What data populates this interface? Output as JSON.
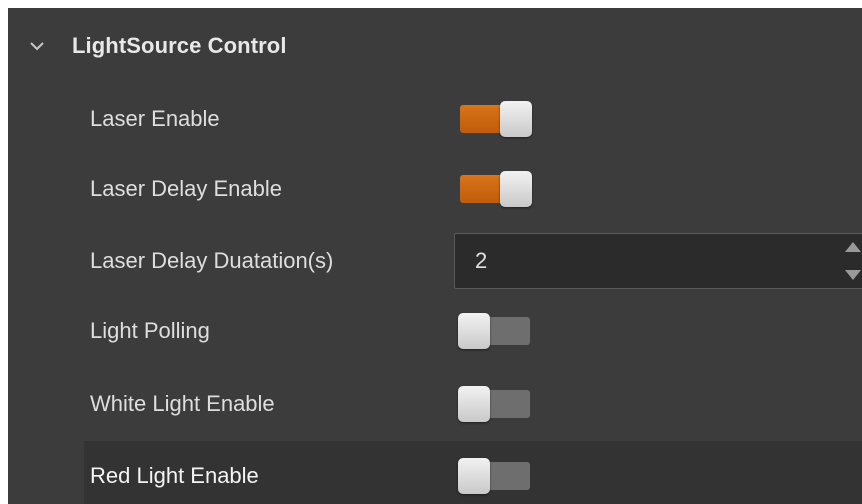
{
  "section": {
    "title": "LightSource Control",
    "expanded": true,
    "chevron_icon": "chevron-down-icon"
  },
  "colors": {
    "panel_background": "#3c3c3c",
    "toggle_on": "#d06a14",
    "toggle_off": "#6e6e6e",
    "selected_row": "#333333"
  },
  "rows": [
    {
      "label": "Laser Enable",
      "type": "toggle",
      "value": true
    },
    {
      "label": "Laser Delay Enable",
      "type": "toggle",
      "value": true
    },
    {
      "label": "Laser Delay Duatation(s)",
      "type": "spinbox",
      "value": "2"
    },
    {
      "label": "Light Polling",
      "type": "toggle",
      "value": false
    },
    {
      "label": "White Light Enable",
      "type": "toggle",
      "value": false
    },
    {
      "label": "Red Light Enable",
      "type": "toggle",
      "value": false,
      "selected": true
    }
  ]
}
